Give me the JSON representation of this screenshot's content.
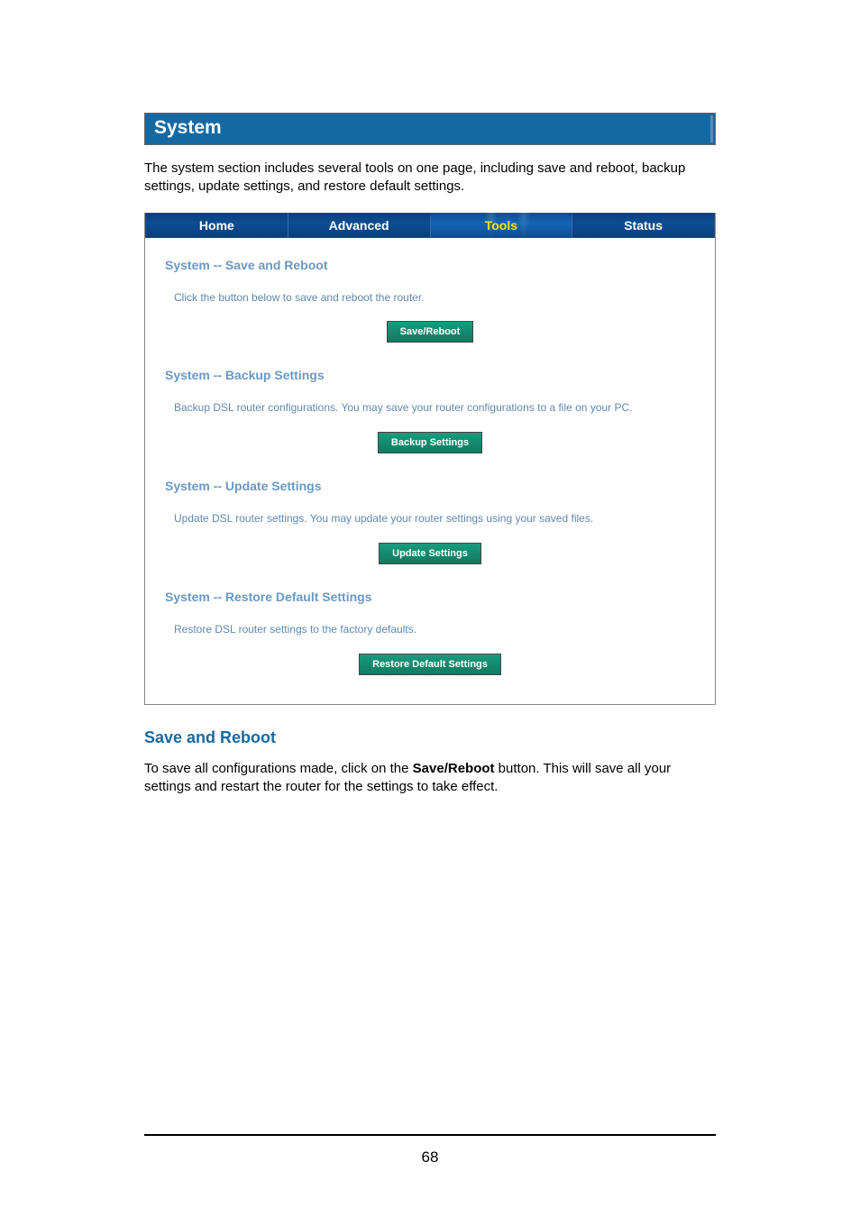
{
  "banner_title": "System",
  "intro": "The system section includes several tools on one page, including save and reboot, backup settings, update settings, and restore default settings.",
  "tabs": {
    "home": "Home",
    "advanced": "Advanced",
    "tools": "Tools",
    "status": "Status"
  },
  "sections": {
    "save_reboot": {
      "title": "System -- Save and Reboot",
      "desc": "Click the button below to save and reboot the router.",
      "button": "Save/Reboot"
    },
    "backup": {
      "title": "System -- Backup Settings",
      "desc": "Backup DSL router configurations. You may save your router configurations to a file on your PC.",
      "button": "Backup Settings"
    },
    "update": {
      "title": "System -- Update Settings",
      "desc": "Update DSL router settings. You may update your router settings using your saved files.",
      "button": "Update Settings"
    },
    "restore": {
      "title": "System -- Restore Default Settings",
      "desc": "Restore DSL router settings to the factory defaults.",
      "button": "Restore Default Settings"
    }
  },
  "sub_heading": "Save and Reboot",
  "body": {
    "prefix": "To save all configurations made, click on the ",
    "bold": "Save/Reboot",
    "suffix": " button. This will save all your settings and restart the router for the settings to take effect."
  },
  "page_number": "68"
}
